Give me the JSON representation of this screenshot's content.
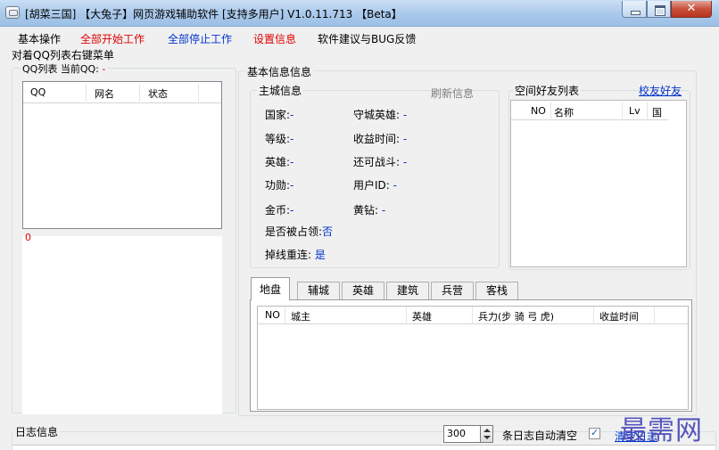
{
  "window": {
    "title": "[胡菜三国] 【大兔子】网页游戏辅助软件 [支持多用户] V1.0.11.713 【Beta】"
  },
  "menu": [
    "基本操作",
    "全部开始工作",
    "全部停止工作",
    "设置信息",
    "软件建议与BUG反馈"
  ],
  "hint": "对着QQ列表右键菜单",
  "qq_panel": {
    "title": "QQ列表 当前QQ:",
    "current_qq": "-",
    "columns": [
      "QQ",
      "网名",
      "状态"
    ],
    "count": "0"
  },
  "base_info": {
    "title": "基本信息信息",
    "main_city": {
      "title": "主城信息",
      "refresh": "刷新信息",
      "fields": [
        {
          "label": "国家:",
          "value": "-"
        },
        {
          "label": "守城英雄:",
          "value": "-"
        },
        {
          "label": "等级:",
          "value": "-"
        },
        {
          "label": "收益时间:",
          "value": "-"
        },
        {
          "label": "英雄:",
          "value": "-"
        },
        {
          "label": "还可战斗:",
          "value": "-"
        },
        {
          "label": "功勋:",
          "value": "-"
        },
        {
          "label": "用户ID:",
          "value": "-"
        },
        {
          "label": "金币:",
          "value": "-"
        },
        {
          "label": "黄钻:",
          "value": "-"
        },
        {
          "label": "是否被占领:",
          "value": "否"
        },
        {
          "label": "掉线重连:",
          "value": "是"
        }
      ]
    },
    "friends": {
      "title": "空间好友列表",
      "check_link": "校友好友",
      "columns": [
        "NO",
        "名称",
        "Lv",
        "国"
      ]
    },
    "tabs": [
      "地盘",
      "辅城",
      "英雄",
      "建筑",
      "兵营",
      "客栈"
    ],
    "land_columns": [
      "NO",
      "城主",
      "英雄",
      "兵力(步 骑 弓 虎)",
      "收益时间"
    ]
  },
  "log": {
    "title": "日志信息",
    "count": "300",
    "auto_clear_label": "条日志自动清空",
    "auto_clear_checked": "✓",
    "clear_link": "清空日志"
  },
  "watermark": "最需网"
}
